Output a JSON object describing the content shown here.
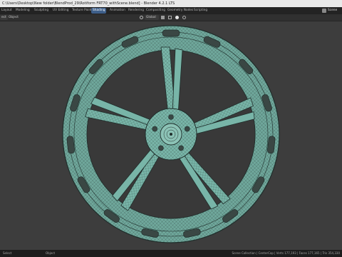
{
  "window": {
    "title": "C:\\Users\\Desktop\\New folder\\BlendProd_29\\Rotiform FRT70_withScene.blend] - Blender 4.2.1 LTS"
  },
  "menubar": {
    "tabs": [
      "Layout",
      "Modeling",
      "Sculpting",
      "UV Editing",
      "Texture Paint",
      "Shading",
      "Animation",
      "Rendering",
      "Compositing",
      "Geometry Nodes",
      "Scripting"
    ],
    "active_tab": "Shading",
    "scene_label": "Scene"
  },
  "header": {
    "left_a": "ect",
    "left_b": "Object",
    "transform_orientation": "Global"
  },
  "viewport": {
    "object": "Rotiform FRT70 wheel (wireframe)",
    "colors": {
      "background": "#3d3d3d",
      "mesh": "#78b5a8",
      "wire": "#1f2e2b"
    }
  },
  "statusbar": {
    "left": "Select",
    "mid": "Object",
    "right": "Scene Collection | CenterCap | Verts 177,193 | Faces 177,165 | Tris 354,330"
  }
}
